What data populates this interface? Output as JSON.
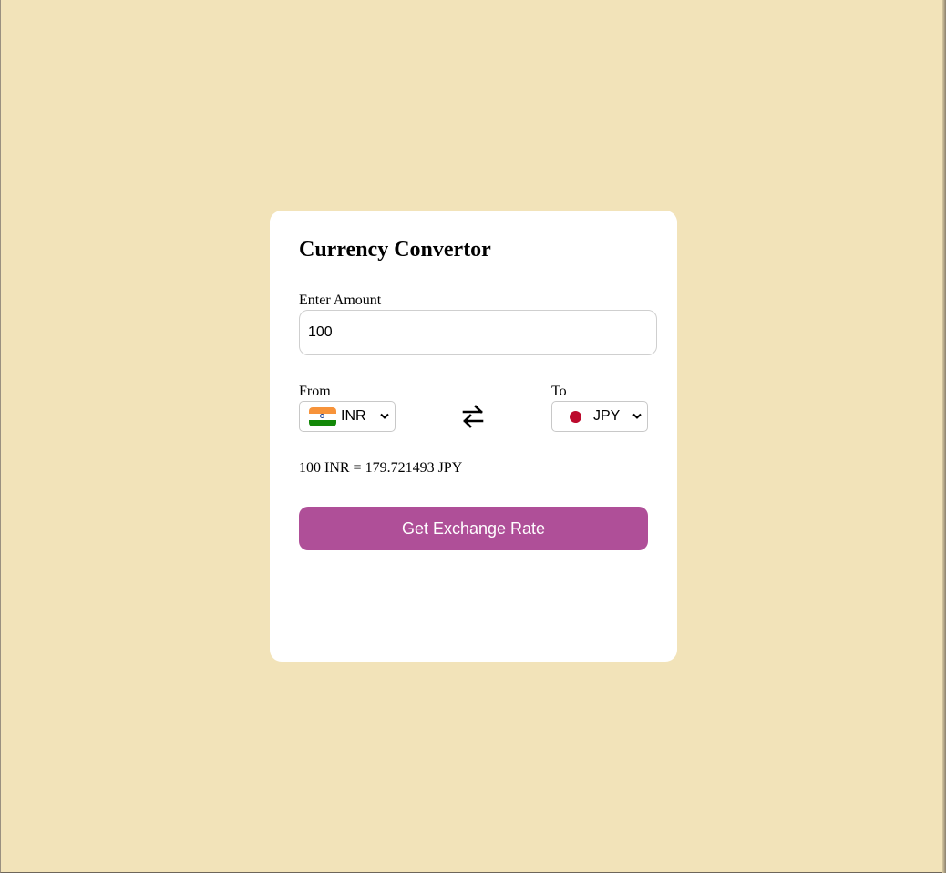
{
  "app": {
    "title": "Currency Convertor"
  },
  "amount": {
    "label": "Enter Amount",
    "value": "100"
  },
  "from": {
    "label": "From",
    "selected": "INR",
    "flag": "india-flag-icon"
  },
  "to": {
    "label": "To",
    "selected": "JPY",
    "flag": "japan-flag-icon"
  },
  "swap": {
    "icon": "swap-arrows-icon"
  },
  "result": {
    "text": "100 INR = 179.721493 JPY"
  },
  "button": {
    "label": "Get Exchange Rate"
  },
  "colors": {
    "background": "#f2e3b9",
    "card": "#ffffff",
    "button": "#af4f98"
  }
}
